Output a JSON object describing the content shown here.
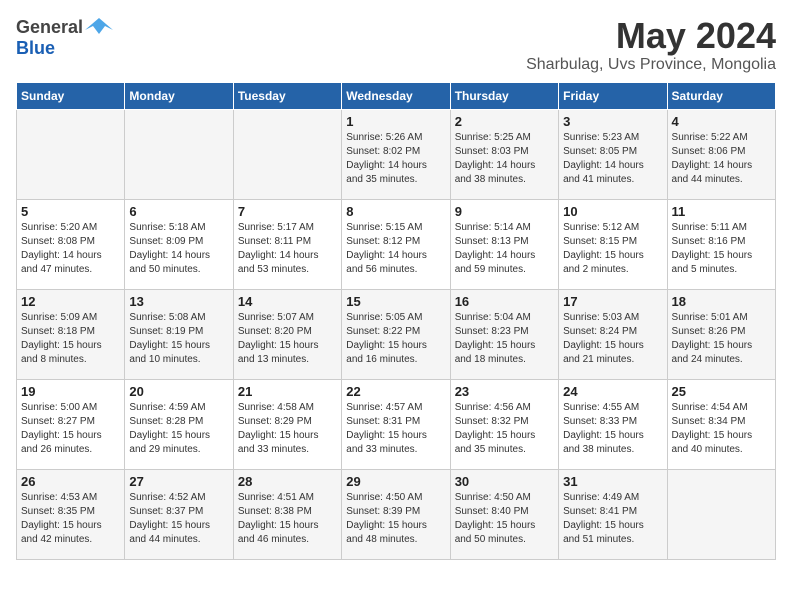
{
  "header": {
    "logo_general": "General",
    "logo_blue": "Blue",
    "month_year": "May 2024",
    "location": "Sharbulag, Uvs Province, Mongolia"
  },
  "days_of_week": [
    "Sunday",
    "Monday",
    "Tuesday",
    "Wednesday",
    "Thursday",
    "Friday",
    "Saturday"
  ],
  "weeks": [
    [
      {
        "day": "",
        "lines": []
      },
      {
        "day": "",
        "lines": []
      },
      {
        "day": "",
        "lines": []
      },
      {
        "day": "1",
        "lines": [
          "Sunrise: 5:26 AM",
          "Sunset: 8:02 PM",
          "Daylight: 14 hours",
          "and 35 minutes."
        ]
      },
      {
        "day": "2",
        "lines": [
          "Sunrise: 5:25 AM",
          "Sunset: 8:03 PM",
          "Daylight: 14 hours",
          "and 38 minutes."
        ]
      },
      {
        "day": "3",
        "lines": [
          "Sunrise: 5:23 AM",
          "Sunset: 8:05 PM",
          "Daylight: 14 hours",
          "and 41 minutes."
        ]
      },
      {
        "day": "4",
        "lines": [
          "Sunrise: 5:22 AM",
          "Sunset: 8:06 PM",
          "Daylight: 14 hours",
          "and 44 minutes."
        ]
      }
    ],
    [
      {
        "day": "5",
        "lines": [
          "Sunrise: 5:20 AM",
          "Sunset: 8:08 PM",
          "Daylight: 14 hours",
          "and 47 minutes."
        ]
      },
      {
        "day": "6",
        "lines": [
          "Sunrise: 5:18 AM",
          "Sunset: 8:09 PM",
          "Daylight: 14 hours",
          "and 50 minutes."
        ]
      },
      {
        "day": "7",
        "lines": [
          "Sunrise: 5:17 AM",
          "Sunset: 8:11 PM",
          "Daylight: 14 hours",
          "and 53 minutes."
        ]
      },
      {
        "day": "8",
        "lines": [
          "Sunrise: 5:15 AM",
          "Sunset: 8:12 PM",
          "Daylight: 14 hours",
          "and 56 minutes."
        ]
      },
      {
        "day": "9",
        "lines": [
          "Sunrise: 5:14 AM",
          "Sunset: 8:13 PM",
          "Daylight: 14 hours",
          "and 59 minutes."
        ]
      },
      {
        "day": "10",
        "lines": [
          "Sunrise: 5:12 AM",
          "Sunset: 8:15 PM",
          "Daylight: 15 hours",
          "and 2 minutes."
        ]
      },
      {
        "day": "11",
        "lines": [
          "Sunrise: 5:11 AM",
          "Sunset: 8:16 PM",
          "Daylight: 15 hours",
          "and 5 minutes."
        ]
      }
    ],
    [
      {
        "day": "12",
        "lines": [
          "Sunrise: 5:09 AM",
          "Sunset: 8:18 PM",
          "Daylight: 15 hours",
          "and 8 minutes."
        ]
      },
      {
        "day": "13",
        "lines": [
          "Sunrise: 5:08 AM",
          "Sunset: 8:19 PM",
          "Daylight: 15 hours",
          "and 10 minutes."
        ]
      },
      {
        "day": "14",
        "lines": [
          "Sunrise: 5:07 AM",
          "Sunset: 8:20 PM",
          "Daylight: 15 hours",
          "and 13 minutes."
        ]
      },
      {
        "day": "15",
        "lines": [
          "Sunrise: 5:05 AM",
          "Sunset: 8:22 PM",
          "Daylight: 15 hours",
          "and 16 minutes."
        ]
      },
      {
        "day": "16",
        "lines": [
          "Sunrise: 5:04 AM",
          "Sunset: 8:23 PM",
          "Daylight: 15 hours",
          "and 18 minutes."
        ]
      },
      {
        "day": "17",
        "lines": [
          "Sunrise: 5:03 AM",
          "Sunset: 8:24 PM",
          "Daylight: 15 hours",
          "and 21 minutes."
        ]
      },
      {
        "day": "18",
        "lines": [
          "Sunrise: 5:01 AM",
          "Sunset: 8:26 PM",
          "Daylight: 15 hours",
          "and 24 minutes."
        ]
      }
    ],
    [
      {
        "day": "19",
        "lines": [
          "Sunrise: 5:00 AM",
          "Sunset: 8:27 PM",
          "Daylight: 15 hours",
          "and 26 minutes."
        ]
      },
      {
        "day": "20",
        "lines": [
          "Sunrise: 4:59 AM",
          "Sunset: 8:28 PM",
          "Daylight: 15 hours",
          "and 29 minutes."
        ]
      },
      {
        "day": "21",
        "lines": [
          "Sunrise: 4:58 AM",
          "Sunset: 8:29 PM",
          "Daylight: 15 hours",
          "and 33 minutes."
        ]
      },
      {
        "day": "22",
        "lines": [
          "Sunrise: 4:57 AM",
          "Sunset: 8:31 PM",
          "Daylight: 15 hours",
          "and 33 minutes."
        ]
      },
      {
        "day": "23",
        "lines": [
          "Sunrise: 4:56 AM",
          "Sunset: 8:32 PM",
          "Daylight: 15 hours",
          "and 35 minutes."
        ]
      },
      {
        "day": "24",
        "lines": [
          "Sunrise: 4:55 AM",
          "Sunset: 8:33 PM",
          "Daylight: 15 hours",
          "and 38 minutes."
        ]
      },
      {
        "day": "25",
        "lines": [
          "Sunrise: 4:54 AM",
          "Sunset: 8:34 PM",
          "Daylight: 15 hours",
          "and 40 minutes."
        ]
      }
    ],
    [
      {
        "day": "26",
        "lines": [
          "Sunrise: 4:53 AM",
          "Sunset: 8:35 PM",
          "Daylight: 15 hours",
          "and 42 minutes."
        ]
      },
      {
        "day": "27",
        "lines": [
          "Sunrise: 4:52 AM",
          "Sunset: 8:37 PM",
          "Daylight: 15 hours",
          "and 44 minutes."
        ]
      },
      {
        "day": "28",
        "lines": [
          "Sunrise: 4:51 AM",
          "Sunset: 8:38 PM",
          "Daylight: 15 hours",
          "and 46 minutes."
        ]
      },
      {
        "day": "29",
        "lines": [
          "Sunrise: 4:50 AM",
          "Sunset: 8:39 PM",
          "Daylight: 15 hours",
          "and 48 minutes."
        ]
      },
      {
        "day": "30",
        "lines": [
          "Sunrise: 4:50 AM",
          "Sunset: 8:40 PM",
          "Daylight: 15 hours",
          "and 50 minutes."
        ]
      },
      {
        "day": "31",
        "lines": [
          "Sunrise: 4:49 AM",
          "Sunset: 8:41 PM",
          "Daylight: 15 hours",
          "and 51 minutes."
        ]
      },
      {
        "day": "",
        "lines": []
      }
    ]
  ]
}
